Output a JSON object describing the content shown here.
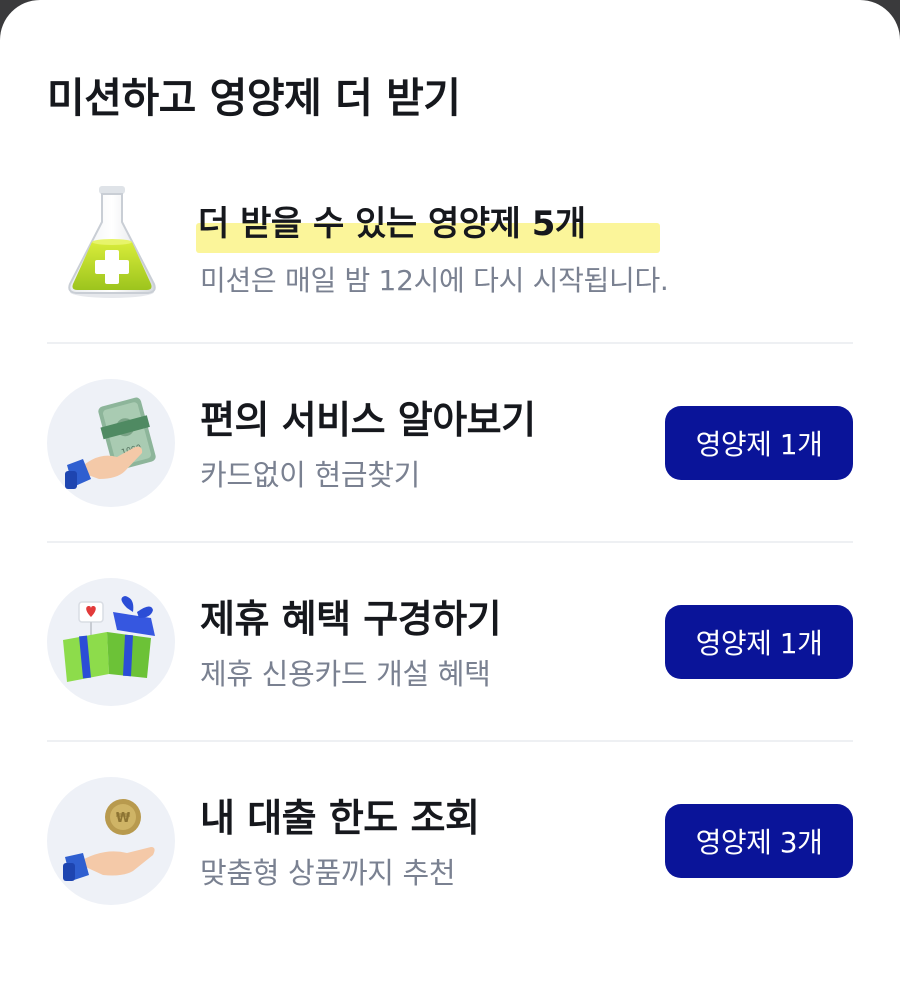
{
  "header": {
    "title": "미션하고 영양제 더 받기"
  },
  "summary": {
    "headline": "더 받을 수 있는 영양제 5개",
    "subtext": "미션은 매일 밤 12시에 다시 시작됩니다.",
    "icon": "flask-icon",
    "highlight_color": "#fbf59a"
  },
  "missions": [
    {
      "title": "편의 서비스 알아보기",
      "desc": "카드없이 현금찾기",
      "reward": "영양제 1개",
      "icon": "cash-hand-icon"
    },
    {
      "title": "제휴 혜택 구경하기",
      "desc": "제휴 신용카드 개설 혜택",
      "reward": "영양제 1개",
      "icon": "gift-box-icon"
    },
    {
      "title": "내 대출 한도 조회",
      "desc": "맞춤형 상품까지 추천",
      "reward": "영양제 3개",
      "icon": "coin-hand-icon"
    }
  ],
  "colors": {
    "accent": "#0a1499",
    "text_primary": "#16181d",
    "text_secondary": "#7a8191"
  }
}
